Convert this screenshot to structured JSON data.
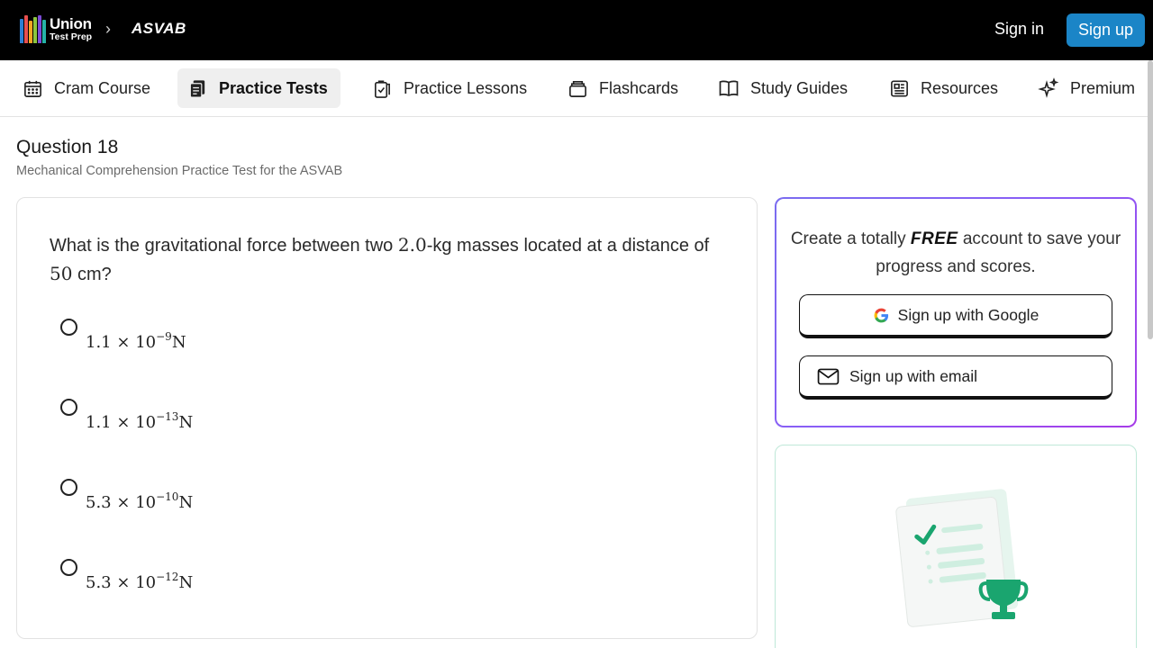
{
  "header": {
    "logo_line1": "Union",
    "logo_line2": "Test Prep",
    "breadcrumb_sep": "›",
    "breadcrumb": "ASVAB",
    "sign_in": "Sign in",
    "sign_up": "Sign up",
    "logo_book_colors": [
      "#2d7fd3",
      "#e84f4f",
      "#f4a623",
      "#8cc63f",
      "#7b4bd6",
      "#25b3a7",
      "#f06ba8"
    ]
  },
  "nav": {
    "items": [
      {
        "label": "Cram Course",
        "icon": "calendar-icon",
        "active": false
      },
      {
        "label": "Practice Tests",
        "icon": "test-sheets-icon",
        "active": true
      },
      {
        "label": "Practice Lessons",
        "icon": "clipboard-check-icon",
        "active": false
      },
      {
        "label": "Flashcards",
        "icon": "cards-stack-icon",
        "active": false
      },
      {
        "label": "Study Guides",
        "icon": "open-book-icon",
        "active": false
      },
      {
        "label": "Resources",
        "icon": "newspaper-icon",
        "active": false
      },
      {
        "label": "Premium",
        "icon": "sparkles-icon",
        "active": false
      }
    ]
  },
  "question": {
    "title": "Question 18",
    "subtitle": "Mechanical Comprehension Practice Test for the ASVAB",
    "text_part1": "What is the gravitational force between two ",
    "mass_value": "2.0",
    "text_part2": "-kg masses located at a distance of ",
    "distance_value": "50",
    "text_part3": " cm?",
    "options": [
      {
        "mantissa": "1.1",
        "base": "10",
        "exponent": "−9",
        "unit": "N"
      },
      {
        "mantissa": "1.1",
        "base": "10",
        "exponent": "−13",
        "unit": "N"
      },
      {
        "mantissa": "5.3",
        "base": "10",
        "exponent": "−10",
        "unit": "N"
      },
      {
        "mantissa": "5.3",
        "base": "10",
        "exponent": "−12",
        "unit": "N"
      }
    ],
    "times_symbol": "×"
  },
  "signup_card": {
    "msg_part1": "Create a totally ",
    "msg_free": "FREE",
    "msg_part2": " account to save your progress and scores.",
    "google_button": "Sign up with Google",
    "email_button": "Sign up with email"
  },
  "colors": {
    "topbar_bg": "#000000",
    "signup_blue": "#1b85c7",
    "card_gradient_start": "#7a6cf0",
    "card_gradient_end": "#a63be8",
    "illustration_green": "#1aa56f"
  }
}
